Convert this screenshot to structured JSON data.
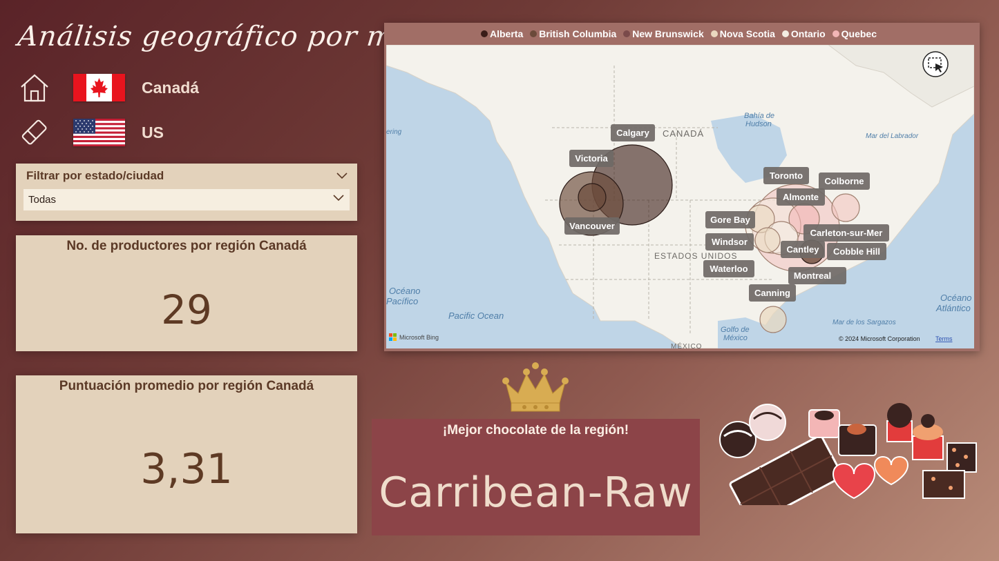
{
  "title": "Análisis geográfico por marca",
  "nav": {
    "canada_label": "Canadá",
    "us_label": "US"
  },
  "filter": {
    "title": "Filtrar por estado/ciudad",
    "selected": "Todas"
  },
  "kpi_producers": {
    "title": "No. de productores por región Canadá",
    "value": "29"
  },
  "kpi_rating": {
    "title": "Puntuación promedio por región Canadá",
    "value": "3,31"
  },
  "map": {
    "legend": [
      {
        "label": "Alberta",
        "color": "#3a1c18"
      },
      {
        "label": "British Columbia",
        "color": "#6b4a3a"
      },
      {
        "label": "New Brunswick",
        "color": "#7a4a4a"
      },
      {
        "label": "Nova Scotia",
        "color": "#ead8bf"
      },
      {
        "label": "Ontario",
        "color": "#f4ede2"
      },
      {
        "label": "Quebec",
        "color": "#f2b6b6"
      }
    ],
    "region_labels": {
      "canada": "CANADÁ",
      "usa": "ESTADOS UNIDOS",
      "mexico": "MÉXICO",
      "hudson_1": "Bahía de",
      "hudson_2": "Hudson",
      "labrador": "Mar del Labrador",
      "pacific_1": "Océano",
      "pacific_2": "Pacífico",
      "pacific_ocean": "Pacific Ocean",
      "atlantic_1": "Océano",
      "atlantic_2": "Atlántico",
      "gulf_1": "Golfo de",
      "gulf_2": "México",
      "sargasso": "Mar de los Sargazos",
      "bering": "ering"
    },
    "city_labels": {
      "calgary": "Calgary",
      "victoria": "Victoria",
      "vancouver": "Vancouver",
      "toronto": "Toronto",
      "colborne": "Colborne",
      "almonte": "Almonte",
      "gore_bay": "Gore Bay",
      "windsor": "Windsor",
      "carleton": "Carleton-sur-Mer",
      "cantley": "Cantley",
      "cobble_hill": "Cobble Hill",
      "waterloo": "Waterloo",
      "montreal": "Montreal",
      "canning": "Canning"
    },
    "attribution": {
      "bing": "Microsoft Bing",
      "copyright": "© 2024 Microsoft Corporation",
      "terms": "Terms"
    }
  },
  "best": {
    "label": "¡Mejor chocolate de la región!",
    "value": "Carribean-Raw"
  }
}
